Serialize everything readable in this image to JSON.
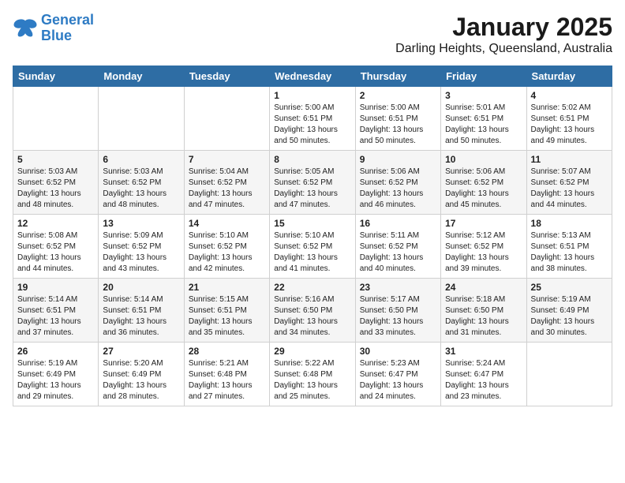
{
  "header": {
    "logo_line1": "General",
    "logo_line2": "Blue",
    "month": "January 2025",
    "location": "Darling Heights, Queensland, Australia"
  },
  "days_of_week": [
    "Sunday",
    "Monday",
    "Tuesday",
    "Wednesday",
    "Thursday",
    "Friday",
    "Saturday"
  ],
  "weeks": [
    [
      {
        "day": "",
        "info": ""
      },
      {
        "day": "",
        "info": ""
      },
      {
        "day": "",
        "info": ""
      },
      {
        "day": "1",
        "info": "Sunrise: 5:00 AM\nSunset: 6:51 PM\nDaylight: 13 hours\nand 50 minutes."
      },
      {
        "day": "2",
        "info": "Sunrise: 5:00 AM\nSunset: 6:51 PM\nDaylight: 13 hours\nand 50 minutes."
      },
      {
        "day": "3",
        "info": "Sunrise: 5:01 AM\nSunset: 6:51 PM\nDaylight: 13 hours\nand 50 minutes."
      },
      {
        "day": "4",
        "info": "Sunrise: 5:02 AM\nSunset: 6:51 PM\nDaylight: 13 hours\nand 49 minutes."
      }
    ],
    [
      {
        "day": "5",
        "info": "Sunrise: 5:03 AM\nSunset: 6:52 PM\nDaylight: 13 hours\nand 48 minutes."
      },
      {
        "day": "6",
        "info": "Sunrise: 5:03 AM\nSunset: 6:52 PM\nDaylight: 13 hours\nand 48 minutes."
      },
      {
        "day": "7",
        "info": "Sunrise: 5:04 AM\nSunset: 6:52 PM\nDaylight: 13 hours\nand 47 minutes."
      },
      {
        "day": "8",
        "info": "Sunrise: 5:05 AM\nSunset: 6:52 PM\nDaylight: 13 hours\nand 47 minutes."
      },
      {
        "day": "9",
        "info": "Sunrise: 5:06 AM\nSunset: 6:52 PM\nDaylight: 13 hours\nand 46 minutes."
      },
      {
        "day": "10",
        "info": "Sunrise: 5:06 AM\nSunset: 6:52 PM\nDaylight: 13 hours\nand 45 minutes."
      },
      {
        "day": "11",
        "info": "Sunrise: 5:07 AM\nSunset: 6:52 PM\nDaylight: 13 hours\nand 44 minutes."
      }
    ],
    [
      {
        "day": "12",
        "info": "Sunrise: 5:08 AM\nSunset: 6:52 PM\nDaylight: 13 hours\nand 44 minutes."
      },
      {
        "day": "13",
        "info": "Sunrise: 5:09 AM\nSunset: 6:52 PM\nDaylight: 13 hours\nand 43 minutes."
      },
      {
        "day": "14",
        "info": "Sunrise: 5:10 AM\nSunset: 6:52 PM\nDaylight: 13 hours\nand 42 minutes."
      },
      {
        "day": "15",
        "info": "Sunrise: 5:10 AM\nSunset: 6:52 PM\nDaylight: 13 hours\nand 41 minutes."
      },
      {
        "day": "16",
        "info": "Sunrise: 5:11 AM\nSunset: 6:52 PM\nDaylight: 13 hours\nand 40 minutes."
      },
      {
        "day": "17",
        "info": "Sunrise: 5:12 AM\nSunset: 6:52 PM\nDaylight: 13 hours\nand 39 minutes."
      },
      {
        "day": "18",
        "info": "Sunrise: 5:13 AM\nSunset: 6:51 PM\nDaylight: 13 hours\nand 38 minutes."
      }
    ],
    [
      {
        "day": "19",
        "info": "Sunrise: 5:14 AM\nSunset: 6:51 PM\nDaylight: 13 hours\nand 37 minutes."
      },
      {
        "day": "20",
        "info": "Sunrise: 5:14 AM\nSunset: 6:51 PM\nDaylight: 13 hours\nand 36 minutes."
      },
      {
        "day": "21",
        "info": "Sunrise: 5:15 AM\nSunset: 6:51 PM\nDaylight: 13 hours\nand 35 minutes."
      },
      {
        "day": "22",
        "info": "Sunrise: 5:16 AM\nSunset: 6:50 PM\nDaylight: 13 hours\nand 34 minutes."
      },
      {
        "day": "23",
        "info": "Sunrise: 5:17 AM\nSunset: 6:50 PM\nDaylight: 13 hours\nand 33 minutes."
      },
      {
        "day": "24",
        "info": "Sunrise: 5:18 AM\nSunset: 6:50 PM\nDaylight: 13 hours\nand 31 minutes."
      },
      {
        "day": "25",
        "info": "Sunrise: 5:19 AM\nSunset: 6:49 PM\nDaylight: 13 hours\nand 30 minutes."
      }
    ],
    [
      {
        "day": "26",
        "info": "Sunrise: 5:19 AM\nSunset: 6:49 PM\nDaylight: 13 hours\nand 29 minutes."
      },
      {
        "day": "27",
        "info": "Sunrise: 5:20 AM\nSunset: 6:49 PM\nDaylight: 13 hours\nand 28 minutes."
      },
      {
        "day": "28",
        "info": "Sunrise: 5:21 AM\nSunset: 6:48 PM\nDaylight: 13 hours\nand 27 minutes."
      },
      {
        "day": "29",
        "info": "Sunrise: 5:22 AM\nSunset: 6:48 PM\nDaylight: 13 hours\nand 25 minutes."
      },
      {
        "day": "30",
        "info": "Sunrise: 5:23 AM\nSunset: 6:47 PM\nDaylight: 13 hours\nand 24 minutes."
      },
      {
        "day": "31",
        "info": "Sunrise: 5:24 AM\nSunset: 6:47 PM\nDaylight: 13 hours\nand 23 minutes."
      },
      {
        "day": "",
        "info": ""
      }
    ]
  ]
}
